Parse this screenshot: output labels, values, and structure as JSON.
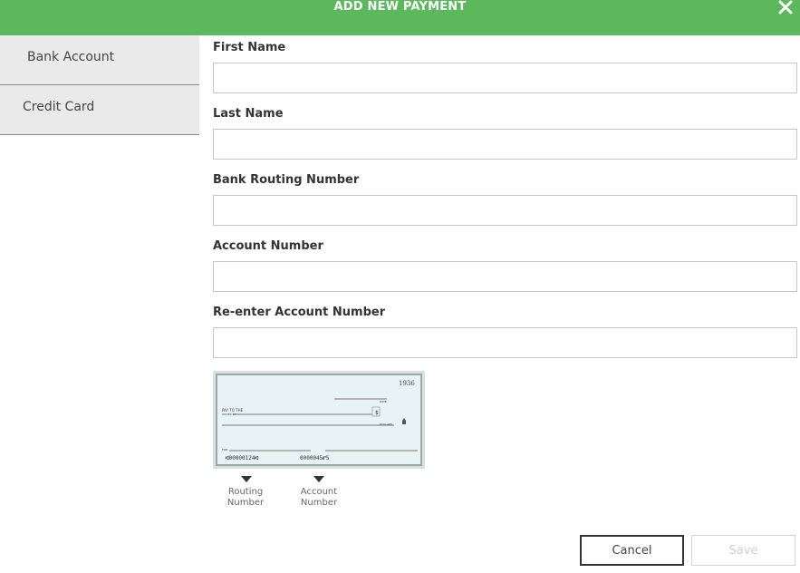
{
  "header": {
    "title": "ADD NEW PAYMENT",
    "close_icon": "close-icon"
  },
  "sidebar": {
    "items": [
      {
        "label": "Bank Account"
      },
      {
        "label": "Credit Card"
      }
    ]
  },
  "form": {
    "fields": [
      {
        "label": "First Name",
        "value": ""
      },
      {
        "label": "Last Name",
        "value": ""
      },
      {
        "label": "Bank Routing Number",
        "value": ""
      },
      {
        "label": "Account Number",
        "value": ""
      },
      {
        "label": "Re-enter Account Number",
        "value": ""
      }
    ]
  },
  "check": {
    "number": "1936",
    "date_label": "DATE",
    "dollars_label": "DOLLARS",
    "for_label": "FOR",
    "routing_label": "Routing Number",
    "account_label": "Account Number"
  },
  "buttons": {
    "cancel_label": "Cancel",
    "save_label": "Save"
  },
  "colors": {
    "header": "#5cb85c",
    "sidebar_bg": "#eaeaea",
    "check_bg": "#e8f3f5"
  }
}
